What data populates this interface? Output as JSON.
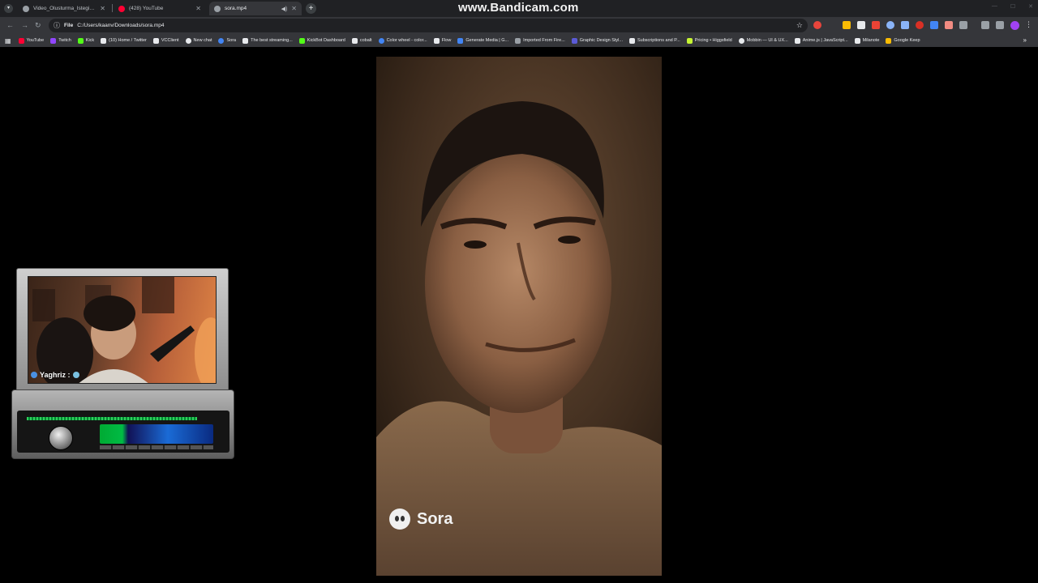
{
  "watermark": "www.Bandicam.com",
  "tabs": [
    {
      "label": "Video_Olusturma_Istegi.mp4",
      "favicon_color": "#9aa0a6"
    },
    {
      "label": "(428) YouTube",
      "favicon_color": "#ff0033"
    },
    {
      "label": "sora.mp4",
      "favicon_color": "#9aa0a6"
    }
  ],
  "omnibox": {
    "scheme": "File",
    "url": "C:/Users/kaanv/Downloads/sora.mp4"
  },
  "bookmarks": [
    {
      "label": "YouTube",
      "color": "#ff0033"
    },
    {
      "label": "Twitch",
      "color": "#9146ff"
    },
    {
      "label": "Kick",
      "color": "#53fc18"
    },
    {
      "label": "(10) Home / Twitter",
      "color": "#e8eaed"
    },
    {
      "label": "VCClient",
      "color": "#e8eaed"
    },
    {
      "label": "New chat",
      "color": "#e8eaed"
    },
    {
      "label": "Sora",
      "color": "#4285f4"
    },
    {
      "label": "The best streaming...",
      "color": "#e8eaed"
    },
    {
      "label": "KickBot Dashboard",
      "color": "#53fc18"
    },
    {
      "label": "cobalt",
      "color": "#e8eaed"
    },
    {
      "label": "Color wheel - color...",
      "color": "#4285f4"
    },
    {
      "label": "Flow",
      "color": "#e8eaed"
    },
    {
      "label": "Generate Media | G...",
      "color": "#4285f4"
    },
    {
      "label": "Imported From Fire...",
      "color": "#9aa0a6"
    },
    {
      "label": "Graphic Design Styl...",
      "color": "#5b5bd6"
    },
    {
      "label": "Subscriptions and P...",
      "color": "#e8eaed"
    },
    {
      "label": "Pricing • Higgsfield",
      "color": "#c6f432"
    },
    {
      "label": "Mobbin — UI & UX...",
      "color": "#e8eaed"
    },
    {
      "label": "Anime.js | JavaScript...",
      "color": "#e8eaed"
    },
    {
      "label": "Milanote",
      "color": "#e8eaed"
    },
    {
      "label": "Google Keep",
      "color": "#fbbc04"
    }
  ],
  "video": {
    "badge": "Sora"
  },
  "overlay": {
    "username": "Yaghriz :"
  }
}
